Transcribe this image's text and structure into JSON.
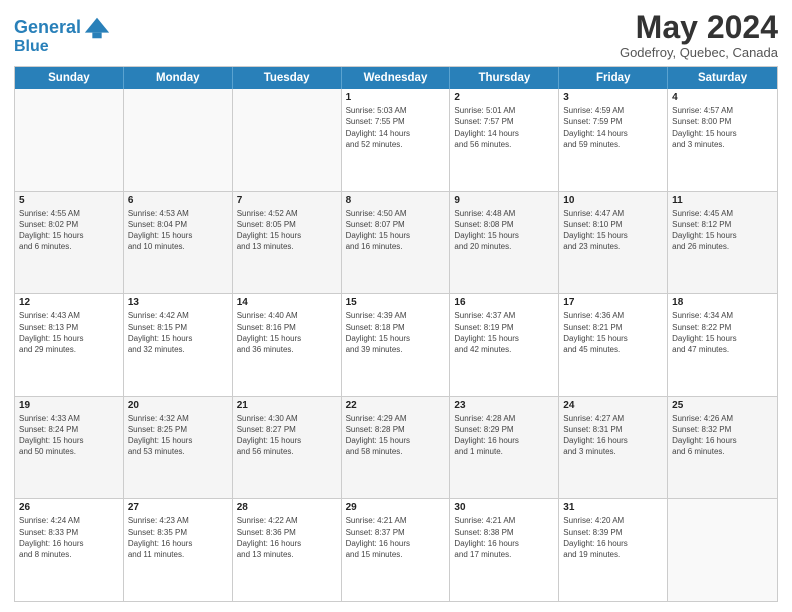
{
  "header": {
    "logo_line1": "General",
    "logo_line2": "Blue",
    "month_title": "May 2024",
    "subtitle": "Godefroy, Quebec, Canada"
  },
  "days_of_week": [
    "Sunday",
    "Monday",
    "Tuesday",
    "Wednesday",
    "Thursday",
    "Friday",
    "Saturday"
  ],
  "rows": [
    [
      {
        "day": "",
        "info": ""
      },
      {
        "day": "",
        "info": ""
      },
      {
        "day": "",
        "info": ""
      },
      {
        "day": "1",
        "info": "Sunrise: 5:03 AM\nSunset: 7:55 PM\nDaylight: 14 hours\nand 52 minutes."
      },
      {
        "day": "2",
        "info": "Sunrise: 5:01 AM\nSunset: 7:57 PM\nDaylight: 14 hours\nand 56 minutes."
      },
      {
        "day": "3",
        "info": "Sunrise: 4:59 AM\nSunset: 7:59 PM\nDaylight: 14 hours\nand 59 minutes."
      },
      {
        "day": "4",
        "info": "Sunrise: 4:57 AM\nSunset: 8:00 PM\nDaylight: 15 hours\nand 3 minutes."
      }
    ],
    [
      {
        "day": "5",
        "info": "Sunrise: 4:55 AM\nSunset: 8:02 PM\nDaylight: 15 hours\nand 6 minutes."
      },
      {
        "day": "6",
        "info": "Sunrise: 4:53 AM\nSunset: 8:04 PM\nDaylight: 15 hours\nand 10 minutes."
      },
      {
        "day": "7",
        "info": "Sunrise: 4:52 AM\nSunset: 8:05 PM\nDaylight: 15 hours\nand 13 minutes."
      },
      {
        "day": "8",
        "info": "Sunrise: 4:50 AM\nSunset: 8:07 PM\nDaylight: 15 hours\nand 16 minutes."
      },
      {
        "day": "9",
        "info": "Sunrise: 4:48 AM\nSunset: 8:08 PM\nDaylight: 15 hours\nand 20 minutes."
      },
      {
        "day": "10",
        "info": "Sunrise: 4:47 AM\nSunset: 8:10 PM\nDaylight: 15 hours\nand 23 minutes."
      },
      {
        "day": "11",
        "info": "Sunrise: 4:45 AM\nSunset: 8:12 PM\nDaylight: 15 hours\nand 26 minutes."
      }
    ],
    [
      {
        "day": "12",
        "info": "Sunrise: 4:43 AM\nSunset: 8:13 PM\nDaylight: 15 hours\nand 29 minutes."
      },
      {
        "day": "13",
        "info": "Sunrise: 4:42 AM\nSunset: 8:15 PM\nDaylight: 15 hours\nand 32 minutes."
      },
      {
        "day": "14",
        "info": "Sunrise: 4:40 AM\nSunset: 8:16 PM\nDaylight: 15 hours\nand 36 minutes."
      },
      {
        "day": "15",
        "info": "Sunrise: 4:39 AM\nSunset: 8:18 PM\nDaylight: 15 hours\nand 39 minutes."
      },
      {
        "day": "16",
        "info": "Sunrise: 4:37 AM\nSunset: 8:19 PM\nDaylight: 15 hours\nand 42 minutes."
      },
      {
        "day": "17",
        "info": "Sunrise: 4:36 AM\nSunset: 8:21 PM\nDaylight: 15 hours\nand 45 minutes."
      },
      {
        "day": "18",
        "info": "Sunrise: 4:34 AM\nSunset: 8:22 PM\nDaylight: 15 hours\nand 47 minutes."
      }
    ],
    [
      {
        "day": "19",
        "info": "Sunrise: 4:33 AM\nSunset: 8:24 PM\nDaylight: 15 hours\nand 50 minutes."
      },
      {
        "day": "20",
        "info": "Sunrise: 4:32 AM\nSunset: 8:25 PM\nDaylight: 15 hours\nand 53 minutes."
      },
      {
        "day": "21",
        "info": "Sunrise: 4:30 AM\nSunset: 8:27 PM\nDaylight: 15 hours\nand 56 minutes."
      },
      {
        "day": "22",
        "info": "Sunrise: 4:29 AM\nSunset: 8:28 PM\nDaylight: 15 hours\nand 58 minutes."
      },
      {
        "day": "23",
        "info": "Sunrise: 4:28 AM\nSunset: 8:29 PM\nDaylight: 16 hours\nand 1 minute."
      },
      {
        "day": "24",
        "info": "Sunrise: 4:27 AM\nSunset: 8:31 PM\nDaylight: 16 hours\nand 3 minutes."
      },
      {
        "day": "25",
        "info": "Sunrise: 4:26 AM\nSunset: 8:32 PM\nDaylight: 16 hours\nand 6 minutes."
      }
    ],
    [
      {
        "day": "26",
        "info": "Sunrise: 4:24 AM\nSunset: 8:33 PM\nDaylight: 16 hours\nand 8 minutes."
      },
      {
        "day": "27",
        "info": "Sunrise: 4:23 AM\nSunset: 8:35 PM\nDaylight: 16 hours\nand 11 minutes."
      },
      {
        "day": "28",
        "info": "Sunrise: 4:22 AM\nSunset: 8:36 PM\nDaylight: 16 hours\nand 13 minutes."
      },
      {
        "day": "29",
        "info": "Sunrise: 4:21 AM\nSunset: 8:37 PM\nDaylight: 16 hours\nand 15 minutes."
      },
      {
        "day": "30",
        "info": "Sunrise: 4:21 AM\nSunset: 8:38 PM\nDaylight: 16 hours\nand 17 minutes."
      },
      {
        "day": "31",
        "info": "Sunrise: 4:20 AM\nSunset: 8:39 PM\nDaylight: 16 hours\nand 19 minutes."
      },
      {
        "day": "",
        "info": ""
      }
    ]
  ]
}
